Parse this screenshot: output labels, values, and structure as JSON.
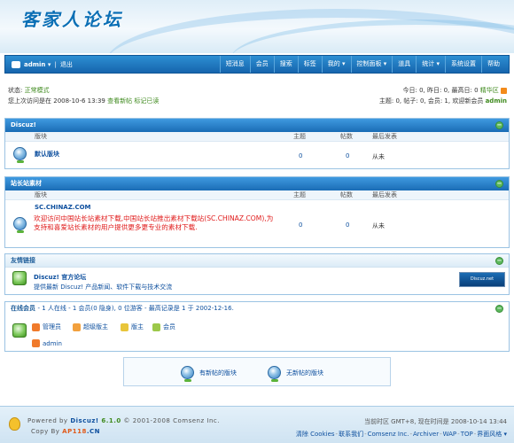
{
  "banner": {
    "logo_text": "客家人论坛"
  },
  "navbar": {
    "username": "admin",
    "username_caret": "admin ▾",
    "logout": "退出",
    "menu": [
      "短消息",
      "会员",
      "搜索",
      "标签",
      "我的 ▾",
      "控制面板 ▾",
      "道具",
      "统计 ▾",
      "系统设置",
      "帮助"
    ]
  },
  "status": {
    "label": "状态:",
    "mode": "正常模式",
    "last_visit_prefix": "您上次访问是在",
    "last_visit_time": "2008-10-6 13:39",
    "view_new": "查看新帖",
    "mark_read": "标记已读"
  },
  "stats": {
    "line1": "今日: 0, 昨日: 0, 最高日: 0",
    "digest": "精华区",
    "line2": "主题: 0, 帖子: 0, 会员: 1, 欢迎新会员",
    "newest_member": "admin"
  },
  "columns": {
    "forum": "版块",
    "topics": "主题",
    "posts": "帖数",
    "last_post": "最后发表"
  },
  "section1": {
    "title": "Discuz!",
    "forum": {
      "name": "默认版块",
      "topics": "0",
      "posts": "0",
      "last_post": "从未"
    }
  },
  "section2": {
    "title": "站长站素材",
    "forum": {
      "name": "SC.CHINAZ.COM",
      "topics": "0",
      "posts": "0",
      "last_post": "从未"
    },
    "ad_text": "欢迎访问中国站长站素材下载,中国站长站推出素材下载站(SC.CHINAZ.COM),为支持和喜爱站长素材的用户提供更多更专业的素材下载."
  },
  "section3": {
    "title": "友情链接",
    "site_name": "Discuz! 官方论坛",
    "site_desc": "提供最新 Discuz! 产品新闻、软件下载与技术交流",
    "banner_text": "Discuz.net"
  },
  "section4": {
    "title": "在线会员",
    "summary": "- 1 人在线 - 1 会员(0 隐身), 0 位游客 - 最高记录是 1 于 2002-12-16.",
    "legend": [
      "管理员",
      "超级版主",
      "版主",
      "会员"
    ],
    "online_user": "admin"
  },
  "icon_legend": {
    "new": "有新帖的版块",
    "none": "无新帖的版块"
  },
  "footer": {
    "powered_prefix": "Powered by",
    "product": "Discuz!",
    "version": "6.1.0",
    "copyright": "© 2001-2008 Comsenz Inc.",
    "copy_by": "Copy By",
    "copy_site": "AP118",
    "copy_tld": ".CN",
    "timezone": "当前时区 GMT+8, 现在时间是 2008-10-14 13:44",
    "links": [
      "清除 Cookies",
      "联系我们",
      "Comsenz Inc.",
      "Archiver",
      "WAP",
      "TOP",
      "界面风格 ▾"
    ]
  },
  "colors": {
    "nav": "#1d72bd",
    "accent_green": "#3f8a1e",
    "ad_red": "#e01a1a",
    "link_blue": "#0d4f9e"
  }
}
